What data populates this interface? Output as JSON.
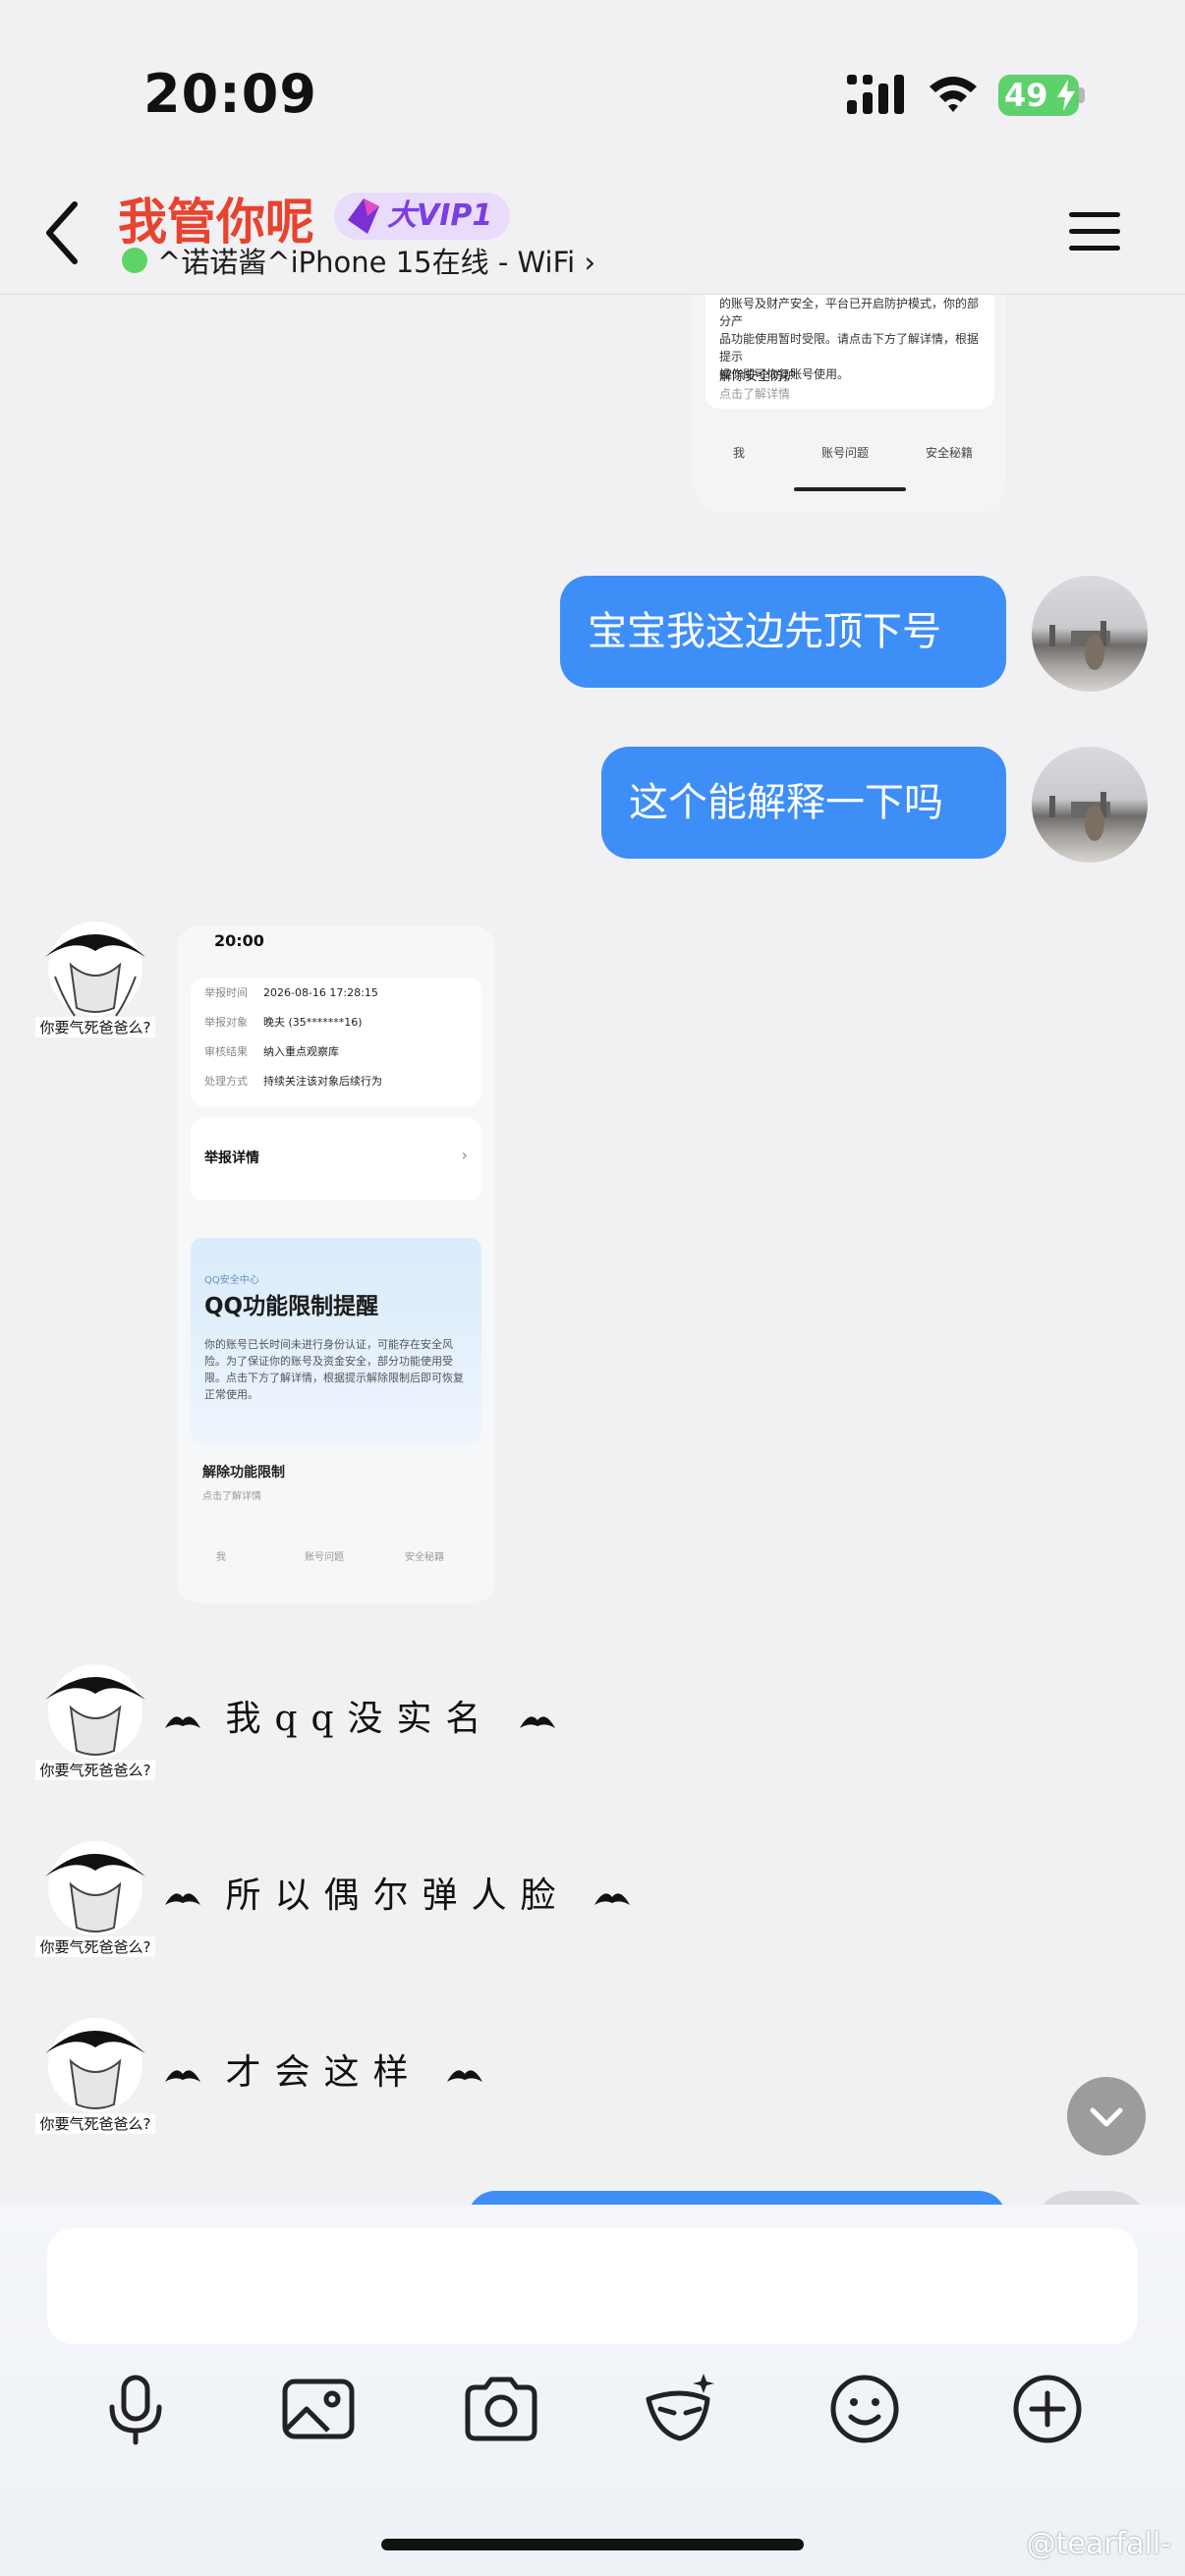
{
  "status_bar": {
    "time": "20:09",
    "battery": "49"
  },
  "header": {
    "title": "我管你呢",
    "vip": "大VIP1",
    "subtitle": "^诺诺酱^iPhone 15在线 - WiFi ›",
    "colors": {
      "title": "#e8432f",
      "online": "#5ed468"
    }
  },
  "messages": {
    "shot_top": {
      "line1": "的账号及财产安全，平台已开启防护模式，你的部分产",
      "line2": "品功能使用暂时受限。请点击下方了解详情，根据提示",
      "line3": "操作即可恢复账号使用。",
      "action": "解除安全防护",
      "action_sub": "点击了解详情",
      "tabs": [
        "我",
        "账号问题",
        "安全秘籍"
      ]
    },
    "out1": "宝宝我这边先顶下号",
    "out2": "这个能解释一下吗",
    "friend_caption": "你要气死爸爸么?",
    "shot_left": {
      "time": "20:00",
      "rows": [
        {
          "k": "举报时间",
          "v": "2026-08-16 17:28:15"
        },
        {
          "k": "举报对象",
          "v": "晚夫 (35*******16)"
        },
        {
          "k": "审核结果",
          "v": "纳入重点观察库"
        },
        {
          "k": "处理方式",
          "v": "持续关注该对象后续行为"
        }
      ],
      "detail": "举报详情",
      "center_label": "QQ安全中心",
      "warn_title": "QQ功能限制提醒",
      "warn_body": "你的账号已长时间未进行身份认证，可能存在安全风险。为了保证你的账号及资金安全，部分功能使用受限。点击下方了解详情，根据提示解除限制后即可恢复正常使用。",
      "unlock": "解除功能限制",
      "unlock_sub": "点击了解详情",
      "tabs": [
        "我",
        "账号问题",
        "安全秘籍"
      ]
    },
    "in1": "我qq没实名",
    "in2": "所以偶尔弹人脸",
    "in3": "才会这样"
  },
  "accent": "#3e8ef7",
  "watermark": "@tearfall-"
}
